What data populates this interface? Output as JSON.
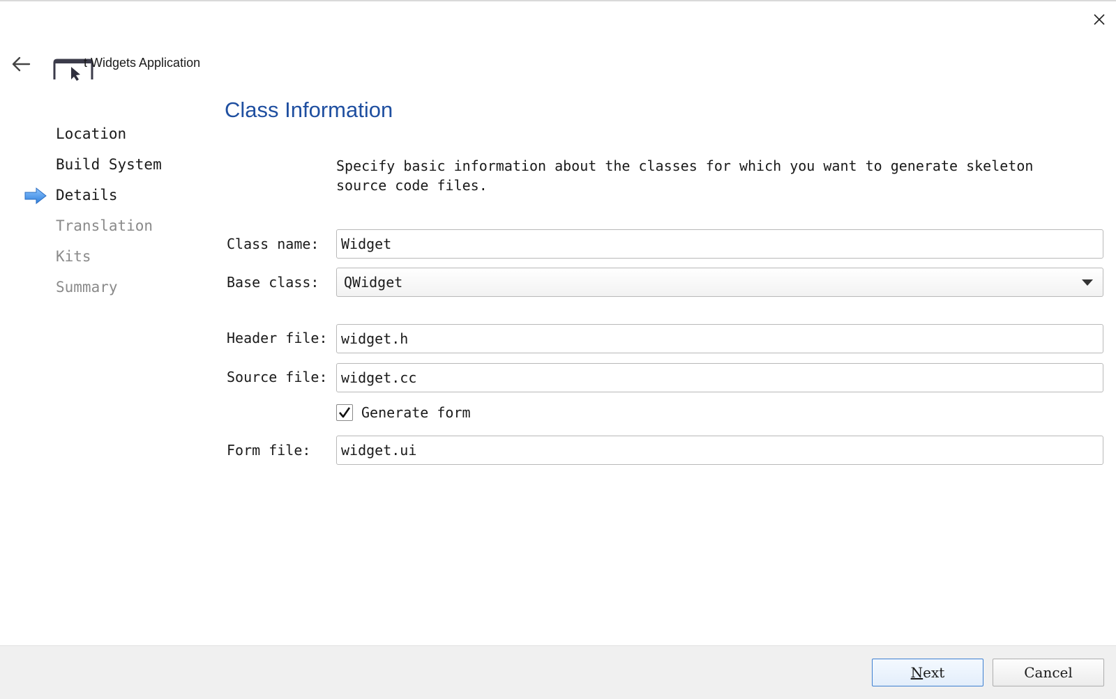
{
  "window": {
    "title": "Qt Widgets Application",
    "title_visible": "t Widgets Application"
  },
  "icons": {
    "close": "close-icon",
    "back": "back-arrow-icon",
    "app": "qt-widgets-app-icon",
    "current_step": "current-step-arrow-icon",
    "checkmark": "checkmark-icon",
    "dropdown": "chevron-down-icon"
  },
  "steps": [
    {
      "label": "Location",
      "state": "done"
    },
    {
      "label": "Build System",
      "state": "done"
    },
    {
      "label": "Details",
      "state": "current"
    },
    {
      "label": "Translation",
      "state": "future"
    },
    {
      "label": "Kits",
      "state": "future"
    },
    {
      "label": "Summary",
      "state": "future"
    }
  ],
  "page": {
    "title": "Class Information",
    "description": "Specify basic information about the classes for which you want to generate skeleton source code files."
  },
  "form": {
    "class_name_label": "Class name:",
    "class_name_value": "Widget",
    "base_class_label": "Base class:",
    "base_class_value": "QWidget",
    "header_file_label": "Header file:",
    "header_file_value": "widget.h",
    "source_file_label": "Source file:",
    "source_file_value": "widget.cc",
    "generate_form_label": "Generate form",
    "generate_form_checked": true,
    "form_file_label": "Form file:",
    "form_file_value": "widget.ui"
  },
  "buttons": {
    "next_mnemonic": "N",
    "next_rest": "ext",
    "cancel": "Cancel"
  },
  "colors": {
    "title_blue": "#1f4fa0",
    "step_arrow_blue": "#3a8ee6",
    "default_button_border": "#3c7fd1",
    "future_step_gray": "#8a8a8a"
  }
}
